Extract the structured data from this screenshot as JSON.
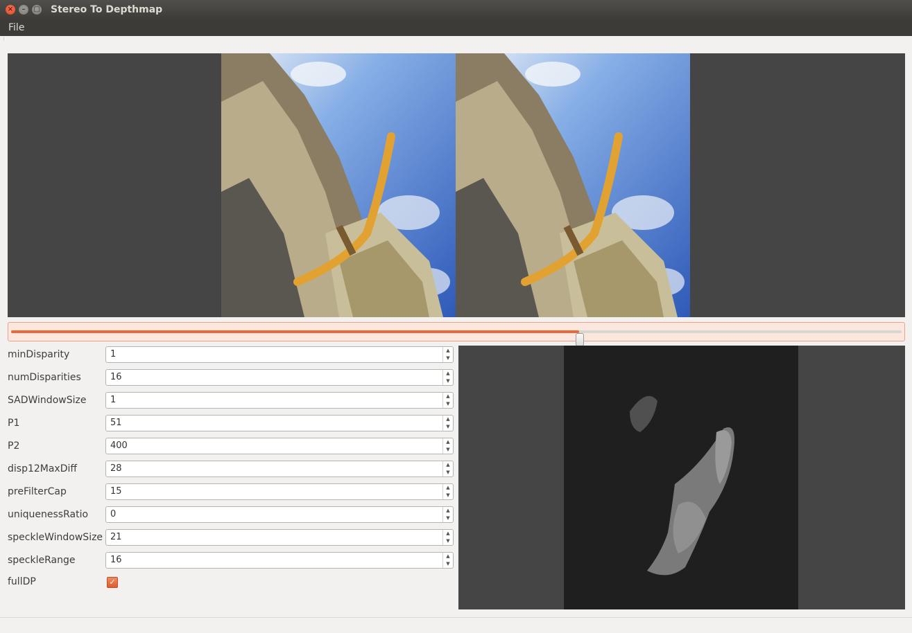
{
  "window": {
    "title": "Stereo To Depthmap"
  },
  "menu": {
    "items": [
      "File"
    ]
  },
  "slider": {
    "value_fraction": 0.638
  },
  "params": [
    {
      "label": "minDisparity",
      "value": "1"
    },
    {
      "label": "numDisparities",
      "value": "16"
    },
    {
      "label": "SADWindowSize",
      "value": "1"
    },
    {
      "label": "P1",
      "value": "51"
    },
    {
      "label": "P2",
      "value": "400"
    },
    {
      "label": "disp12MaxDiff",
      "value": "28"
    },
    {
      "label": "preFilterCap",
      "value": "15"
    },
    {
      "label": "uniquenessRatio",
      "value": "0"
    },
    {
      "label": "speckleWindowSize",
      "value": "21"
    },
    {
      "label": "speckleRange",
      "value": "16"
    }
  ],
  "fullDP": {
    "label": "fullDP",
    "checked": true
  },
  "colors": {
    "accent": "#e76a3c",
    "titlebar": "#3c3b37",
    "viewer_bg": "#454545"
  },
  "icons": {
    "close": "close-icon",
    "minimize": "minimize-icon",
    "maximize": "maximize-icon",
    "check": "check-icon"
  }
}
